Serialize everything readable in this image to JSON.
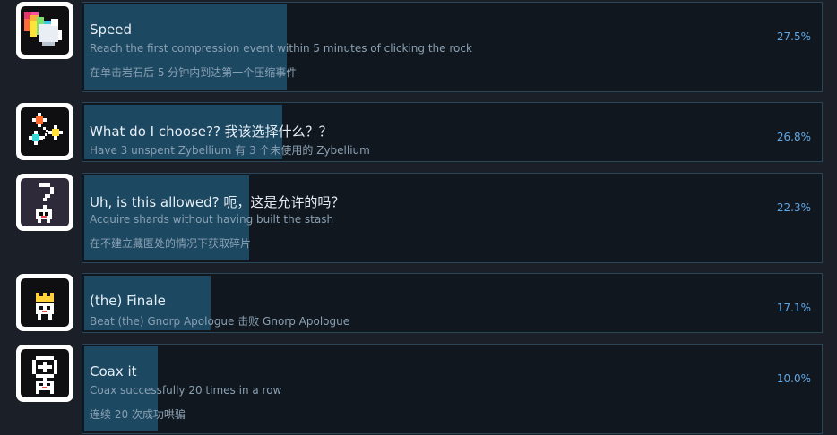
{
  "achievements": [
    {
      "icon": "rainbow-rock-icon",
      "title": "Speed",
      "desc": "Reach the first compression event within 5 minutes of clicking the rock",
      "desc_cn": "在单击岩石后 5 分钟内到达第一个压缩事件",
      "percent_text": "27.5%",
      "percent": 27.5
    },
    {
      "icon": "choice-stars-icon",
      "title": "What do I choose?? 我该选择什么？？",
      "desc": "Have 3 unspent Zybellium 有 3 个未使用的 Zybellium",
      "desc_cn": "",
      "percent_text": "26.8%",
      "percent": 26.8
    },
    {
      "icon": "question-gnorp-icon",
      "title": "Uh, is this allowed?  呃，这是允许的吗？",
      "desc": "Acquire shards without having built the stash",
      "desc_cn": "在不建立藏匿处的情况下获取碎片",
      "percent_text": "22.3%",
      "percent": 22.3
    },
    {
      "icon": "crowned-gnorp-icon",
      "title": "(the) Finale",
      "desc": "Beat (the) Gnorp Apologue 击败 Gnorp Apologue",
      "desc_cn": "",
      "percent_text": "17.1%",
      "percent": 17.1
    },
    {
      "icon": "coax-gnorp-icon",
      "title": "Coax it",
      "desc": "Coax successfully 20 times in a row",
      "desc_cn": "连续 20 次成功哄骗",
      "percent_text": "10.0%",
      "percent": 10.0
    }
  ]
}
